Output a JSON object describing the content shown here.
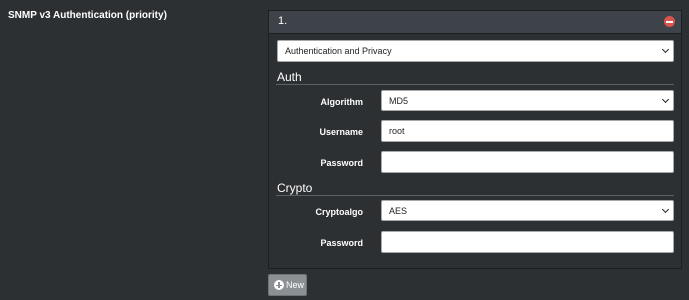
{
  "section": {
    "label": "SNMP v3 Authentication (priority)"
  },
  "entry": {
    "title": "1.",
    "mode_value": "Authentication and Privacy",
    "auth": {
      "heading": "Auth",
      "algorithm_label": "Algorithm",
      "algorithm_value": "MD5",
      "username_label": "Username",
      "username_value": "root",
      "password_label": "Password",
      "password_value": ""
    },
    "crypto": {
      "heading": "Crypto",
      "cryptoalgo_label": "Cryptoalgo",
      "cryptoalgo_value": "AES",
      "password_label": "Password",
      "password_value": ""
    }
  },
  "actions": {
    "new_label": "New"
  },
  "colors": {
    "remove": "#d9534f",
    "background": "#2c3033",
    "header": "#3d4349"
  },
  "icons": {
    "remove": "minus-circle-icon",
    "add": "plus-circle-icon",
    "dropdown": "chevron-down-icon"
  }
}
